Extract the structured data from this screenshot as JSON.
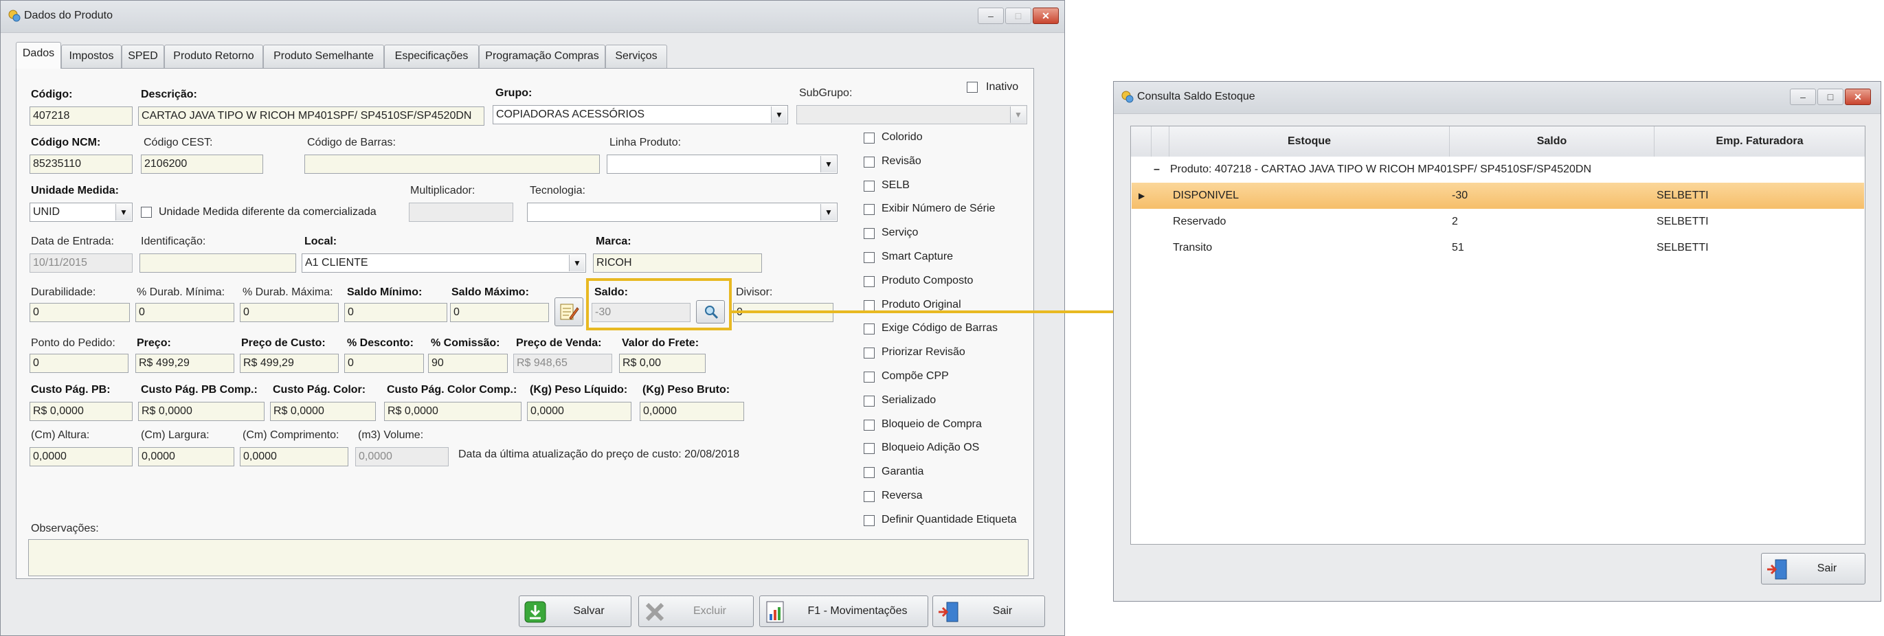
{
  "main_window": {
    "title": "Dados do Produto",
    "tabs": [
      "Dados",
      "Impostos",
      "SPED",
      "Produto Retorno",
      "Produto Semelhante",
      "Especificações",
      "Programação Compras",
      "Serviços"
    ],
    "inativo_label": "Inativo",
    "fields": {
      "codigo": {
        "label": "Código:",
        "value": "407218"
      },
      "descricao": {
        "label": "Descrição:",
        "value": "CARTAO JAVA TIPO W RICOH MP401SPF/ SP4510SF/SP4520DN"
      },
      "grupo": {
        "label": "Grupo:",
        "value": "COPIADORAS ACESSÓRIOS"
      },
      "subgrupo": {
        "label": "SubGrupo:",
        "value": ""
      },
      "ncm": {
        "label": "Código NCM:",
        "value": "85235110"
      },
      "cest": {
        "label": "Código CEST:",
        "value": "2106200"
      },
      "barras": {
        "label": "Código de Barras:",
        "value": ""
      },
      "linha": {
        "label": "Linha Produto:",
        "value": ""
      },
      "unidade": {
        "label": "Unidade Medida:",
        "value": "UNID"
      },
      "unidade_diff": {
        "label": "Unidade Medida diferente da comercializada"
      },
      "multiplicador": {
        "label": "Multiplicador:",
        "value": ""
      },
      "tecnologia": {
        "label": "Tecnologia:",
        "value": ""
      },
      "data_entrada": {
        "label": "Data de Entrada:",
        "value": "10/11/2015"
      },
      "identificacao": {
        "label": "Identificação:",
        "value": ""
      },
      "local": {
        "label": "Local:",
        "value": "A1 CLIENTE"
      },
      "marca": {
        "label": "Marca:",
        "value": "RICOH"
      },
      "durabilidade": {
        "label": "Durabilidade:",
        "value": "0"
      },
      "durab_min": {
        "label": "% Durab. Mínima:",
        "value": "0"
      },
      "durab_max": {
        "label": "% Durab. Máxima:",
        "value": "0"
      },
      "saldo_min": {
        "label": "Saldo Mínimo:",
        "value": "0"
      },
      "saldo_max": {
        "label": "Saldo Máximo:",
        "value": "0"
      },
      "saldo": {
        "label": "Saldo:",
        "value": "-30"
      },
      "divisor": {
        "label": "Divisor:",
        "value": "0"
      },
      "ponto_pedido": {
        "label": "Ponto do Pedido:",
        "value": "0"
      },
      "preco": {
        "label": "Preço:",
        "value": "R$ 499,29"
      },
      "preco_custo": {
        "label": "Preço de Custo:",
        "value": "R$ 499,29"
      },
      "desconto": {
        "label": "% Desconto:",
        "value": "0"
      },
      "comissao": {
        "label": "% Comissão:",
        "value": "90"
      },
      "preco_venda": {
        "label": "Preço de Venda:",
        "value": "R$ 948,65"
      },
      "valor_frete": {
        "label": "Valor do Frete:",
        "value": "R$ 0,00"
      },
      "custo_pb": {
        "label": "Custo Pág. PB:",
        "value": "R$ 0,0000"
      },
      "custo_pb_comp": {
        "label": "Custo Pág. PB Comp.:",
        "value": "R$ 0,0000"
      },
      "custo_color": {
        "label": "Custo Pág. Color:",
        "value": "R$ 0,0000"
      },
      "custo_color_comp": {
        "label": "Custo Pág. Color Comp.:",
        "value": "R$ 0,0000"
      },
      "peso_liquido": {
        "label": "(Kg) Peso Líquido:",
        "value": "0,0000"
      },
      "peso_bruto": {
        "label": "(Kg) Peso Bruto:",
        "value": "0,0000"
      },
      "altura": {
        "label": "(Cm) Altura:",
        "value": "0,0000"
      },
      "largura": {
        "label": "(Cm) Largura:",
        "value": "0,0000"
      },
      "comprimento": {
        "label": "(Cm) Comprimento:",
        "value": "0,0000"
      },
      "volume": {
        "label": "(m3) Volume:",
        "value": "0,0000"
      },
      "ultima_atualizacao": "Data da última atualização do preço de custo: 20/08/2018",
      "observacoes": {
        "label": "Observações:",
        "value": ""
      }
    },
    "checkboxes": [
      "Colorido",
      "Revisão",
      "SELB",
      "Exibir Número de Série",
      "Serviço",
      "Smart Capture",
      "Produto Composto",
      "Produto Original",
      "Exige Código de Barras",
      "Priorizar Revisão",
      "Compõe CPP",
      "Serializado",
      "Bloqueio de Compra",
      "Bloqueio Adição OS",
      "Garantia",
      "Reversa",
      "Definir Quantidade Etiqueta"
    ],
    "buttons": {
      "salvar": "Salvar",
      "excluir": "Excluir",
      "movimentacoes": "F1 - Movimentações",
      "sair": "Sair"
    }
  },
  "stock_window": {
    "title": "Consulta Saldo Estoque",
    "columns": [
      "Estoque",
      "Saldo",
      "Emp. Faturadora"
    ],
    "group_row": "Produto: 407218 - CARTAO JAVA TIPO W RICOH MP401SPF/ SP4510SF/SP4520DN",
    "rows": [
      {
        "estoque": "DISPONIVEL",
        "saldo": "-30",
        "empresa": "SELBETTI"
      },
      {
        "estoque": "Reservado",
        "saldo": "2",
        "empresa": "SELBETTI"
      },
      {
        "estoque": "Transito",
        "saldo": "51",
        "empresa": "SELBETTI"
      }
    ],
    "sair_label": "Sair"
  },
  "colors": {
    "highlight": "#e8b922",
    "selected_row": "#f6be6a",
    "field_bg": "#f7f7e8"
  }
}
